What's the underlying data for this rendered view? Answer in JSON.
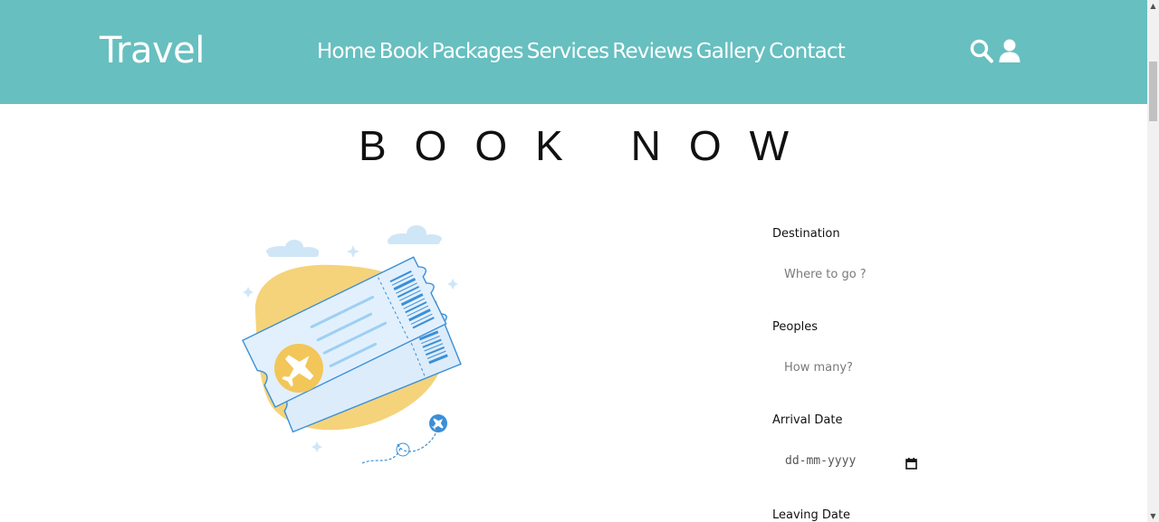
{
  "header": {
    "logo": "Travel",
    "nav": [
      "Home",
      "Book",
      "Packages",
      "Services",
      "Reviews",
      "Gallery",
      "Contact"
    ],
    "icons": [
      "search-icon",
      "user-icon"
    ],
    "background_color": "#67bfc0"
  },
  "heading": "BOOK NOW",
  "illustration": {
    "icons": [
      "ticket-illustration",
      "airplane-icon",
      "cloud-icon"
    ]
  },
  "form": {
    "destination": {
      "label": "Destination",
      "placeholder": "Where to go ?"
    },
    "peoples": {
      "label": "Peoples",
      "placeholder": "How many?"
    },
    "arrival": {
      "label": "Arrival Date",
      "placeholder": "dd-mm-yyyy"
    },
    "leaving": {
      "label": "Leaving Date"
    }
  }
}
